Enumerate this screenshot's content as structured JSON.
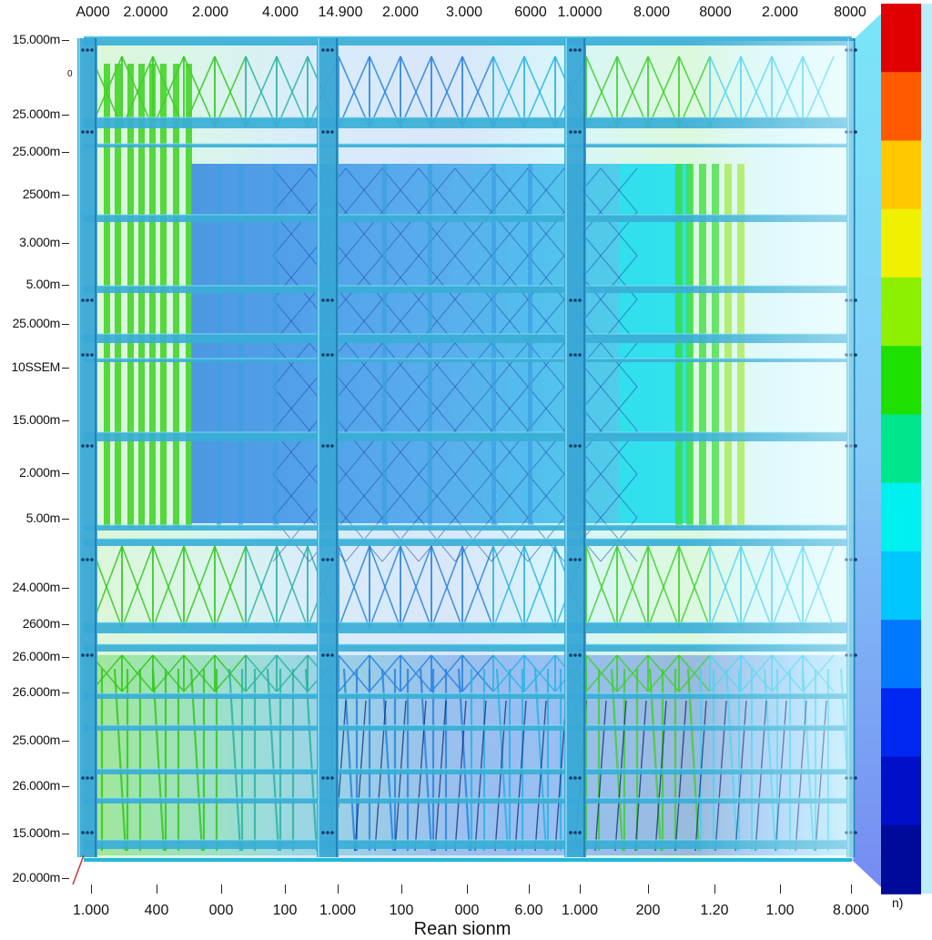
{
  "top_axis": {
    "ticks": [
      "A000",
      "2.0000",
      "2.000",
      "4.000",
      "14.900",
      "2.000",
      "3.000",
      "6000",
      "1.0000",
      "8.000",
      "8000",
      "2.000",
      "8000"
    ]
  },
  "left_axis": {
    "ticks": [
      "15.000m",
      "25.000m",
      "25.000m",
      "2500m",
      "3.000m",
      "5.00m",
      "25.000m",
      "10SSEM",
      "15.000m",
      "2.000m",
      "5.00m",
      "24.000m",
      "2600m",
      "26.000m",
      "26.000m",
      "25.000m",
      "26.000m",
      "15.000m",
      "20.000m"
    ]
  },
  "bottom_axis": {
    "ticks": [
      "1.000",
      "400",
      "000",
      "100",
      "1.000",
      "100",
      "000",
      "6.00",
      "1.000",
      "200",
      "1.20",
      "1.00",
      "8.000"
    ],
    "title": "Rean sionm"
  },
  "colorbar": {
    "unit": "n)",
    "colors": [
      "#e00000",
      "#ff5a00",
      "#ffc800",
      "#f0f000",
      "#8cf000",
      "#1ee000",
      "#00e68c",
      "#00f0f0",
      "#00c8ff",
      "#0078ff",
      "#0028f0",
      "#0010c8",
      "#000a9a"
    ]
  },
  "origin_label": "0",
  "colors": {
    "green": "#30c818",
    "cyan": "#22c4dc",
    "blue": "#1a5ee0",
    "steel": "#2fa6d4"
  }
}
